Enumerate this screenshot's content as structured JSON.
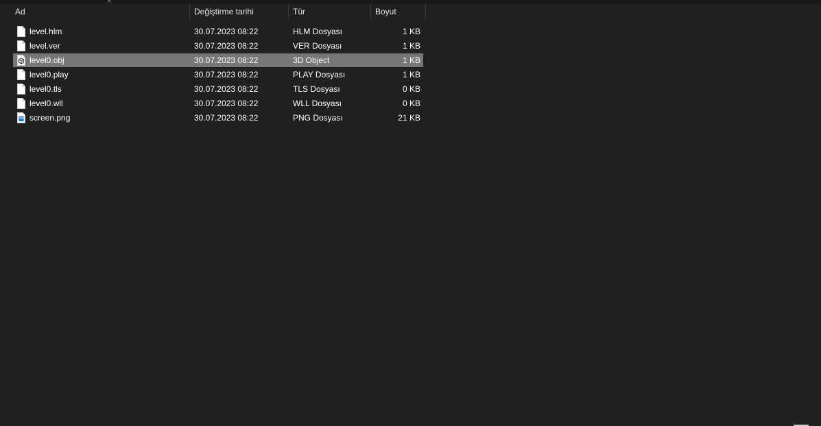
{
  "columns": {
    "name": "Ad",
    "date": "Değiştirme tarihi",
    "type": "Tür",
    "size": "Boyut"
  },
  "sort_indicator": "^",
  "files": [
    {
      "name": "level.hlm",
      "date": "30.07.2023 08:22",
      "type": "HLM Dosyası",
      "size": "1 KB",
      "icon": "document-icon"
    },
    {
      "name": "level.ver",
      "date": "30.07.2023 08:22",
      "type": "VER Dosyası",
      "size": "1 KB",
      "icon": "document-icon"
    },
    {
      "name": "level0.obj",
      "date": "30.07.2023 08:22",
      "type": "3D Object",
      "size": "1 KB",
      "icon": "3d-object-icon",
      "selected": true
    },
    {
      "name": "level0.play",
      "date": "30.07.2023 08:22",
      "type": "PLAY Dosyası",
      "size": "1 KB",
      "icon": "document-icon"
    },
    {
      "name": "level0.tls",
      "date": "30.07.2023 08:22",
      "type": "TLS Dosyası",
      "size": "0 KB",
      "icon": "document-icon"
    },
    {
      "name": "level0.wll",
      "date": "30.07.2023 08:22",
      "type": "WLL Dosyası",
      "size": "0 KB",
      "icon": "document-icon"
    },
    {
      "name": "screen.png",
      "date": "30.07.2023 08:22",
      "type": "PNG Dosyası",
      "size": "21 KB",
      "icon": "image-file-icon"
    }
  ],
  "colors": {
    "background": "#202020",
    "selected_row": "#777777",
    "header_text": "#e4e4e4"
  }
}
